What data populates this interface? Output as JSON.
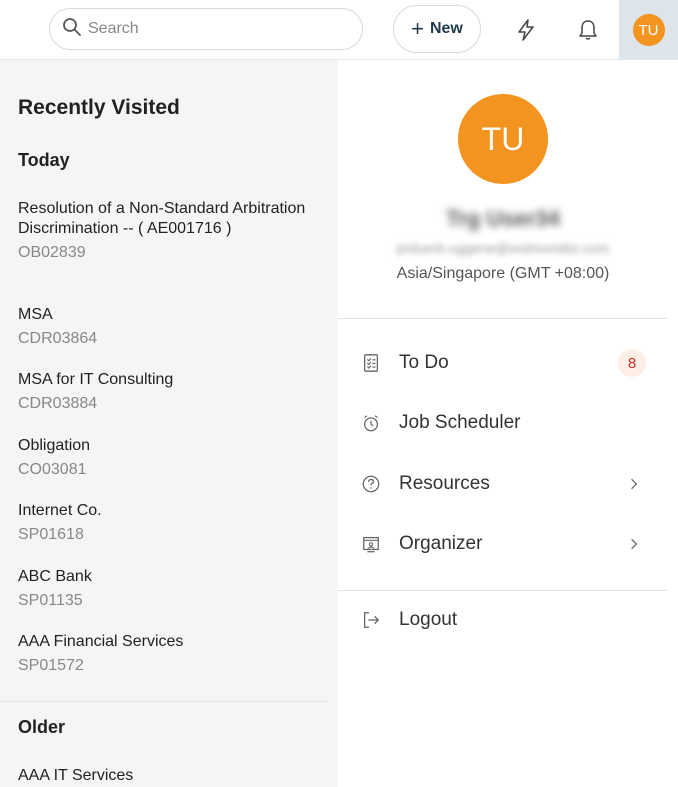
{
  "search": {
    "placeholder": "Search"
  },
  "header": {
    "new_label": "New",
    "avatar_initials": "TU"
  },
  "recent": {
    "title": "Recently Visited",
    "today_label": "Today",
    "older_label": "Older",
    "today_items": [
      {
        "name": "Resolution of a Non-Standard Arbitration Discrimination -- ( AE001716 )",
        "code": "OB02839"
      },
      {
        "name": "MSA",
        "code": "CDR03864"
      },
      {
        "name": "MSA for IT Consulting",
        "code": "CDR03884"
      },
      {
        "name": "Obligation",
        "code": "CO03081"
      },
      {
        "name": "Internet Co.",
        "code": "SP01618"
      },
      {
        "name": "ABC Bank",
        "code": "SP01135"
      },
      {
        "name": "AAA Financial Services",
        "code": "SP01572"
      }
    ],
    "older_items": [
      {
        "name": "AAA IT Services"
      }
    ]
  },
  "profile": {
    "initials": "TU",
    "name": "Trg User34",
    "email": "prduerb.uggene@eotmoriabs.com",
    "timezone": "Asia/Singapore (GMT +08:00)"
  },
  "menu": {
    "todo": {
      "label": "To Do",
      "badge": "8"
    },
    "jobs": {
      "label": "Job Scheduler"
    },
    "resources": {
      "label": "Resources"
    },
    "organizer": {
      "label": "Organizer"
    },
    "logout": {
      "label": "Logout"
    }
  },
  "colors": {
    "accent": "#f39320",
    "badge_text": "#c4322b",
    "badge_bg": "#fdeee6",
    "left_bg": "#f5f5f5",
    "avatar_tab_bg": "#dde4ea"
  },
  "icons": {
    "search": "search-icon",
    "plus": "plus-icon",
    "bolt": "lightning-bolt-icon",
    "bell": "bell-icon",
    "todo": "checklist-icon",
    "jobs": "stopwatch-icon",
    "resources": "question-circle-icon",
    "organizer": "organizer-icon",
    "logout": "logout-icon",
    "chevron": "chevron-right-icon"
  }
}
